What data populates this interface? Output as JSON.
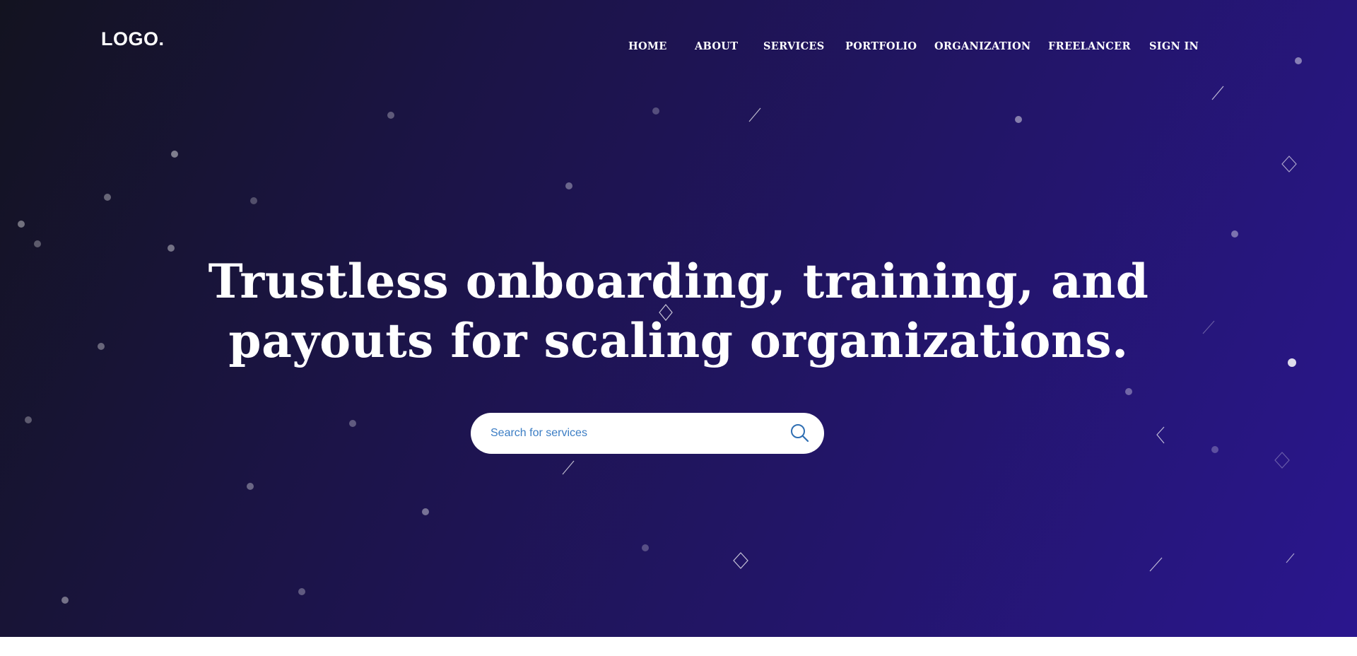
{
  "header": {
    "logo": "LOGO."
  },
  "nav": {
    "items": [
      {
        "id": "home",
        "label": "HOME"
      },
      {
        "id": "about",
        "label": "ABOUT"
      },
      {
        "id": "services",
        "label": "SERVICES"
      },
      {
        "id": "portfolio",
        "label": "PORTFOLIO"
      },
      {
        "id": "organization",
        "label": "ORGANIZATION"
      },
      {
        "id": "freelancer",
        "label": "FREELANCER"
      },
      {
        "id": "sign-in",
        "label": "SIGN IN"
      }
    ]
  },
  "hero": {
    "headline_line1": "Trustless onboarding, training, and",
    "headline_line2": "payouts for scaling organizations."
  },
  "search": {
    "placeholder": "Search for services",
    "icon": "search-icon"
  },
  "theme": {
    "gradient_start": "#131320",
    "gradient_end": "#2a168e",
    "accent": "#2f6fb3",
    "text": "#ffffff"
  }
}
